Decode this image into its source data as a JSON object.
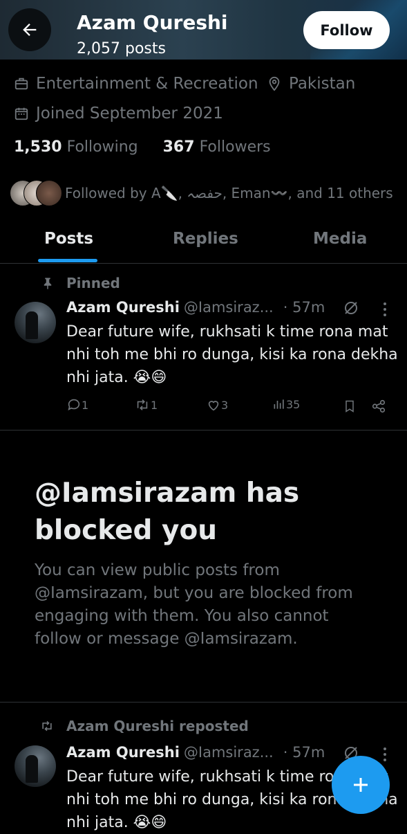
{
  "header": {
    "name": "Azam Qureshi",
    "post_count": "2,057 posts",
    "follow_label": "Follow"
  },
  "profile": {
    "category": "Entertainment & Recreation",
    "location": "Pakistan",
    "joined": "Joined September 2021",
    "following_count": "1,530",
    "following_label": "Following",
    "followers_count": "367",
    "followers_label": "Followers",
    "followed_by": "Followed by A🔪, حفصہ, Eman〰️, and 11 others"
  },
  "tabs": [
    {
      "label": "Posts"
    },
    {
      "label": "Replies"
    },
    {
      "label": "Media"
    }
  ],
  "pinned_post": {
    "pin_label": "Pinned",
    "name": "Azam Qureshi",
    "handle": "@Iamsiraz...",
    "time": "· 57m",
    "text": "Dear future wife, rukhsati k time rona mat nhi toh me bhi ro dunga, kisi ka rona dekha nhi jata. 😭😄",
    "replies": "1",
    "reposts": "1",
    "likes": "3",
    "views": "35"
  },
  "blocked": {
    "title": "@Iamsirazam has blocked you",
    "body": "You can view public posts from @Iamsirazam, but you are blocked from engaging with them. You also cannot follow or message @Iamsirazam."
  },
  "repost": {
    "repost_label": "Azam Qureshi reposted",
    "name": "Azam Qureshi",
    "handle": "@Iamsiraz...",
    "time": "· 57m",
    "text": "Dear future wife, rukhsati k time rona mat nhi toh me bhi ro dunga, kisi ka rona dekha nhi jata. 😭😄"
  },
  "fab": {
    "icon": "plus-icon"
  },
  "colors": {
    "accent": "#1d9bf0",
    "muted": "#71767b",
    "text": "#e7e9ea",
    "background": "#000000"
  }
}
